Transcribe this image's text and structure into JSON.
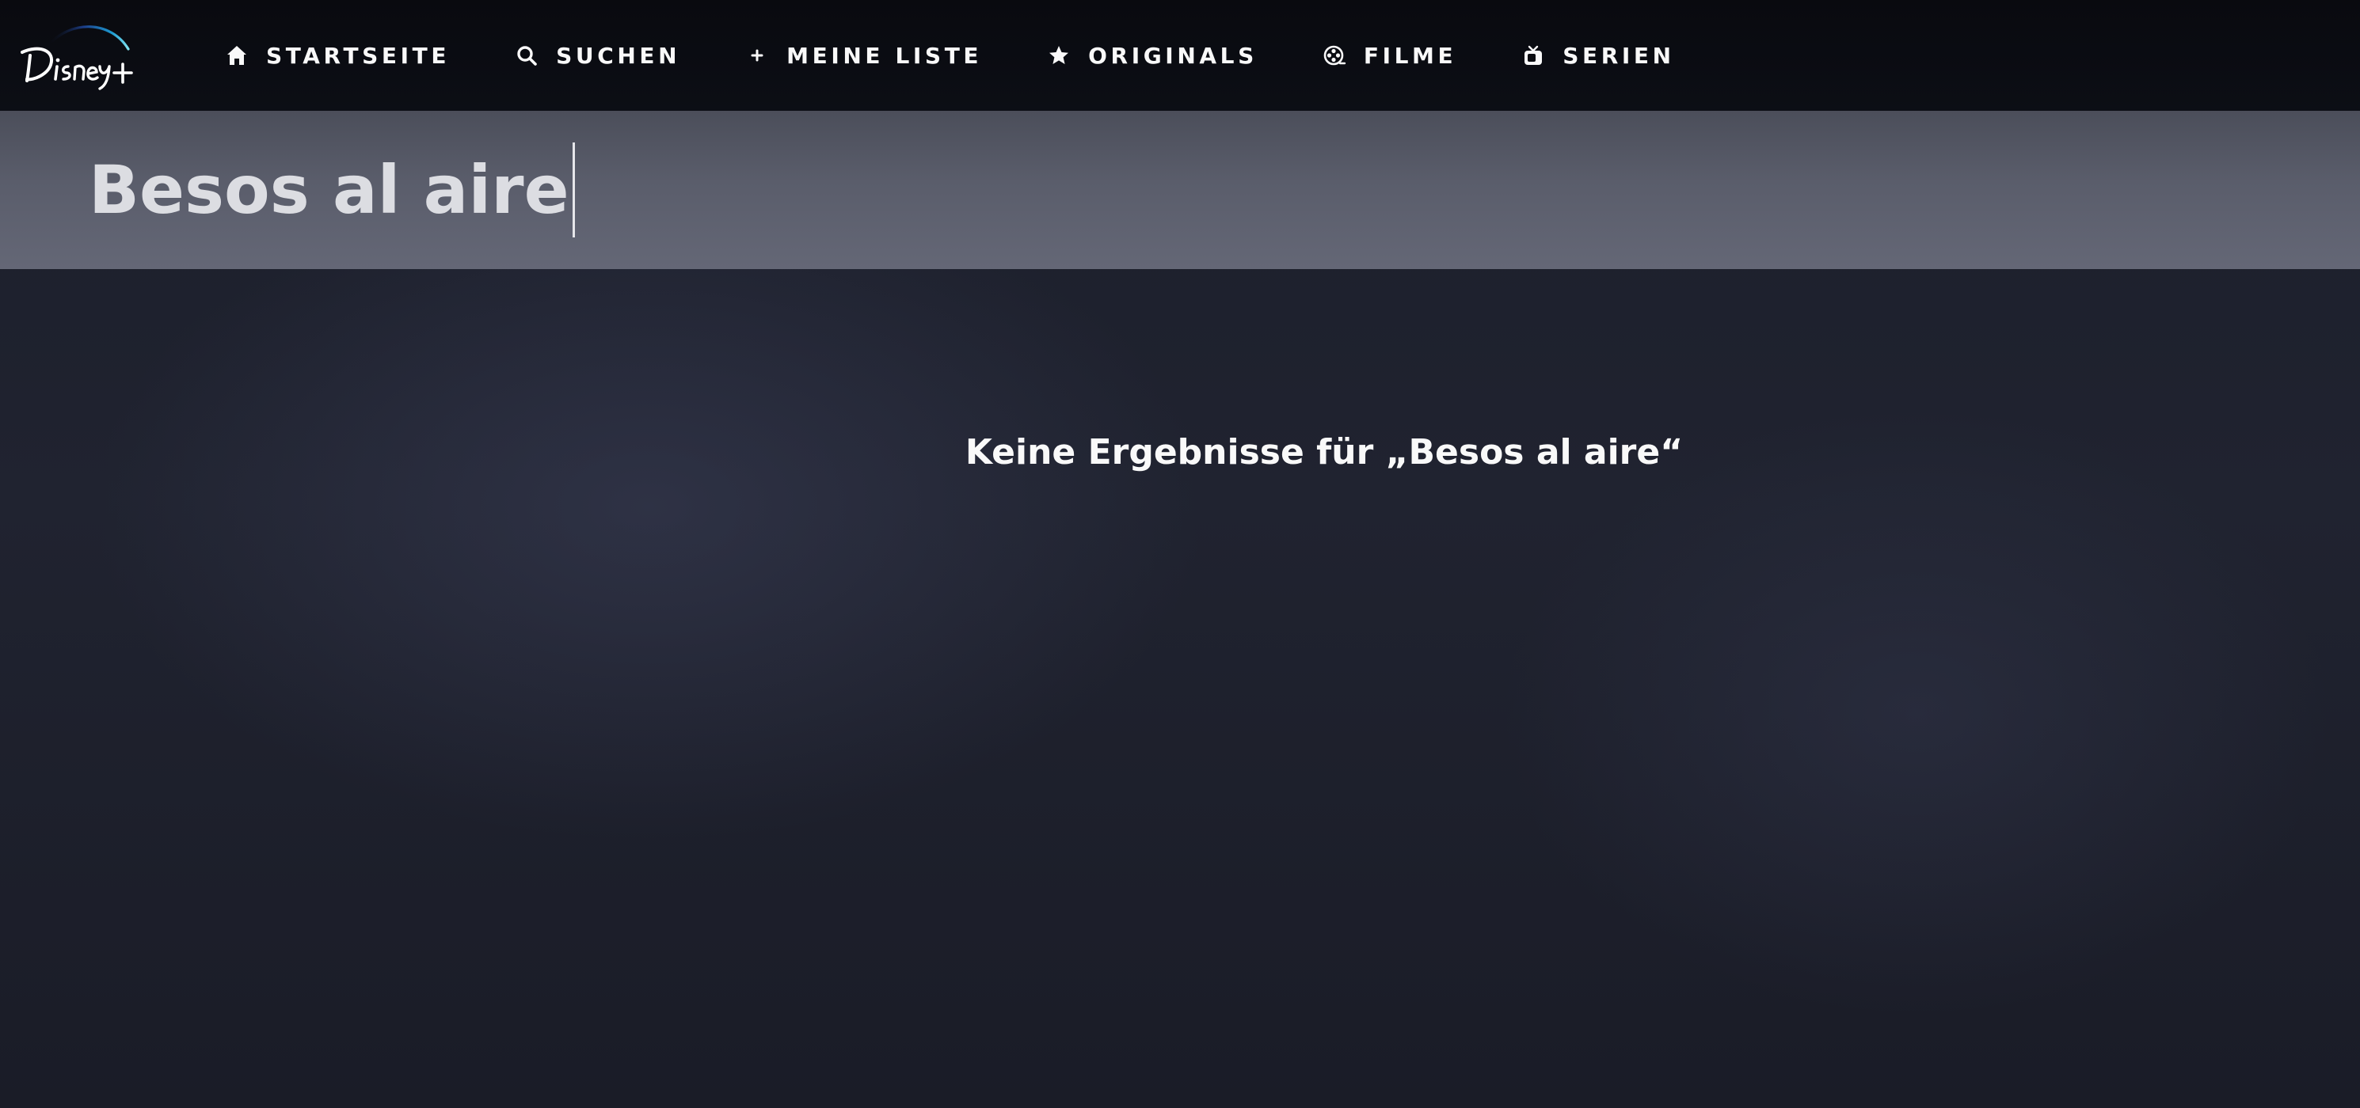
{
  "brand": {
    "logo_text": "Disney+",
    "accent_color": "#1d9bd1"
  },
  "nav": {
    "items": [
      {
        "label": "STARTSEITE",
        "icon": "home-icon"
      },
      {
        "label": "SUCHEN",
        "icon": "search-icon"
      },
      {
        "label": "MEINE LISTE",
        "icon": "plus-icon"
      },
      {
        "label": "ORIGINALS",
        "icon": "star-icon"
      },
      {
        "label": "FILME",
        "icon": "film-reel-icon"
      },
      {
        "label": "SERIEN",
        "icon": "tv-icon"
      }
    ]
  },
  "search": {
    "value": "Besos al aire",
    "placeholder": ""
  },
  "results": {
    "message": "Keine Ergebnisse für „Besos al aire“"
  },
  "colors": {
    "nav_background": "#0b0c11",
    "search_bar_background": "#5a5d6b",
    "page_background": "#1a1d29",
    "text_primary": "#f9f9f9"
  }
}
